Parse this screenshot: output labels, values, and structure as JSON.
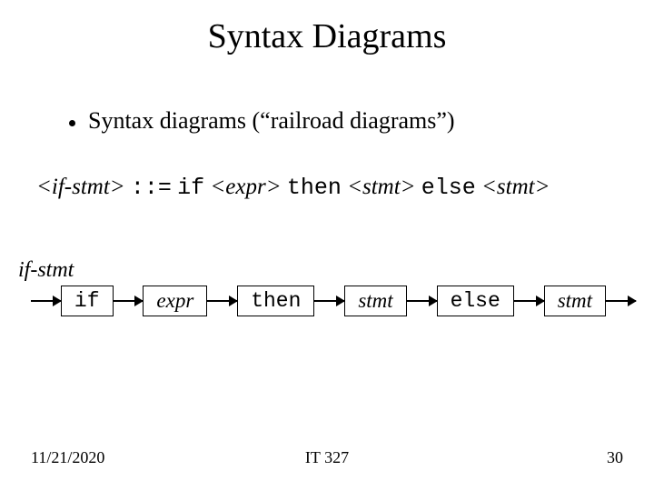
{
  "title": "Syntax Diagrams",
  "bullet": "Syntax diagrams (“railroad diagrams”)",
  "grammar": {
    "lhs": "<if-stmt>",
    "op": "::=",
    "rhs_parts": [
      {
        "text": "if",
        "cls": "mono"
      },
      {
        "text": "<expr>",
        "cls": "italic"
      },
      {
        "text": "then",
        "cls": "mono"
      },
      {
        "text": "<stmt>",
        "cls": "italic"
      },
      {
        "text": "else",
        "cls": "mono"
      },
      {
        "text": "<stmt>",
        "cls": "italic"
      }
    ]
  },
  "diagram": {
    "label": "if-stmt",
    "nodes": [
      {
        "text": "if",
        "style": "mono"
      },
      {
        "text": "expr",
        "style": "italic"
      },
      {
        "text": "then",
        "style": "mono"
      },
      {
        "text": "stmt",
        "style": "italic"
      },
      {
        "text": "else",
        "style": "mono"
      },
      {
        "text": "stmt",
        "style": "italic"
      }
    ]
  },
  "footer": {
    "date": "11/21/2020",
    "course": "IT 327",
    "page": "30"
  }
}
